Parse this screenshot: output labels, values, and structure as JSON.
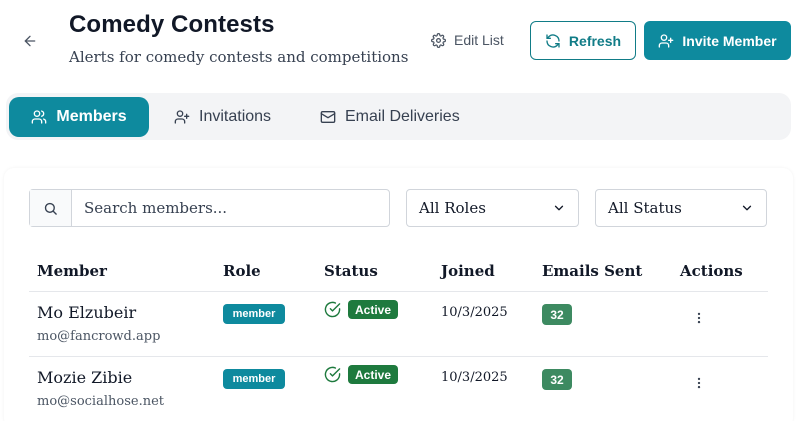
{
  "header": {
    "title": "Comedy Contests",
    "subtitle": "Alerts for comedy contests and competitions",
    "edit_list_label": "Edit List",
    "refresh_label": "Refresh",
    "invite_label": "Invite Member"
  },
  "tabs": [
    {
      "label": "Members",
      "icon": "users-icon",
      "active": true
    },
    {
      "label": "Invitations",
      "icon": "user-plus-icon",
      "active": false
    },
    {
      "label": "Email Deliveries",
      "icon": "mail-icon",
      "active": false
    }
  ],
  "filters": {
    "search_placeholder": "Search members...",
    "role_value": "All Roles",
    "status_value": "All Status"
  },
  "table": {
    "headers": [
      "Member",
      "Role",
      "Status",
      "Joined",
      "Emails Sent",
      "Actions"
    ],
    "rows": [
      {
        "name": "Mo Elzubeir",
        "email": "mo@fancrowd.app",
        "role": "member",
        "status": "Active",
        "joined": "10/3/2025",
        "emails_sent": "32"
      },
      {
        "name": "Mozie Zibie",
        "email": "mo@socialhose.net",
        "role": "member",
        "status": "Active",
        "joined": "10/3/2025",
        "emails_sent": "32"
      }
    ]
  },
  "colors": {
    "accent": "#0e8a9e",
    "status_active": "#1e7a3e",
    "emails_badge": "#3d8a61"
  }
}
